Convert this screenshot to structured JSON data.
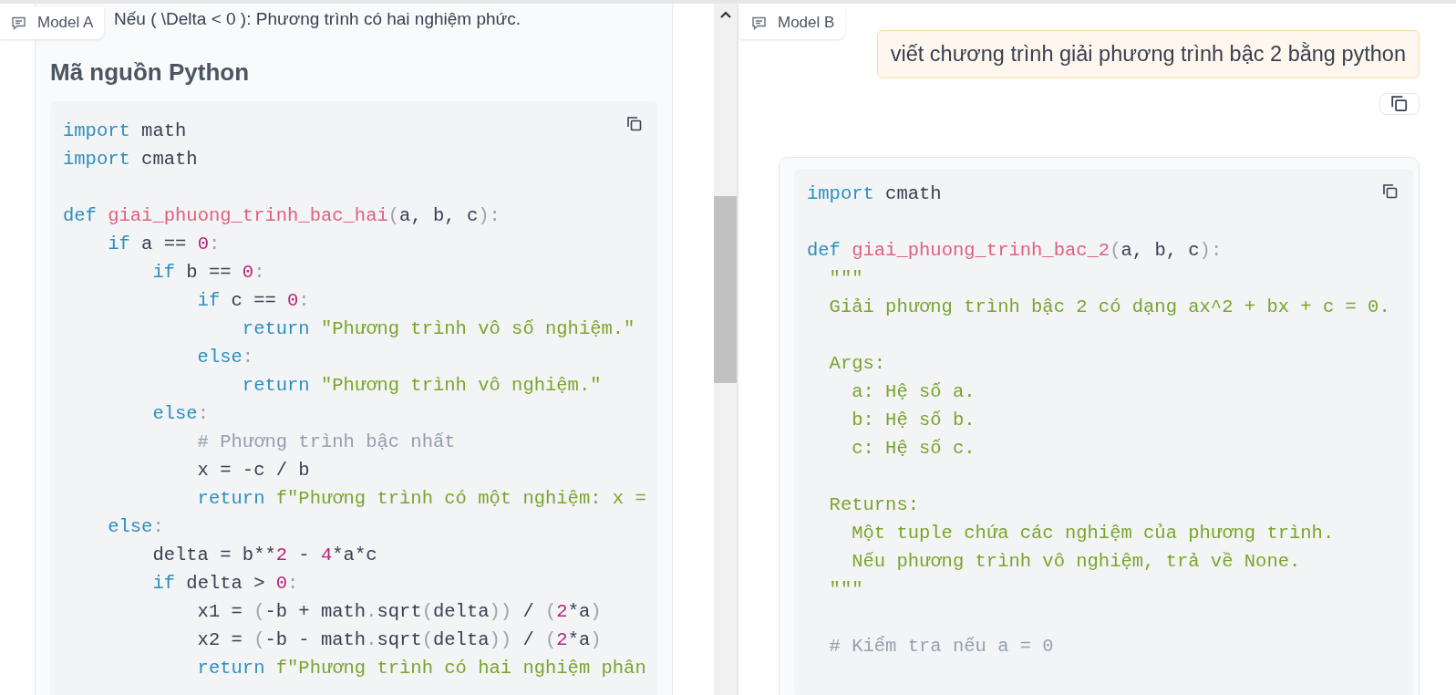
{
  "left_panel": {
    "tag": "Model A",
    "paragraph": "Nếu ( \\Delta < 0 ): Phương trình có hai nghiệm phức.",
    "heading": "Mã nguồn Python",
    "code": [
      {
        "kind": "code",
        "tokens": [
          {
            "kind": "kw",
            "t": "import"
          },
          {
            "kind": "p",
            "t": " math"
          }
        ]
      },
      {
        "kind": "code",
        "tokens": [
          {
            "kind": "kw",
            "t": "import"
          },
          {
            "kind": "p",
            "t": " cmath"
          }
        ]
      },
      {
        "kind": "blank"
      },
      {
        "kind": "code",
        "tokens": [
          {
            "kind": "kw",
            "t": "def "
          },
          {
            "kind": "fn",
            "t": "giai_phuong_trinh_bac_hai"
          },
          {
            "kind": "pu",
            "t": "("
          },
          {
            "kind": "p",
            "t": "a, b, c"
          },
          {
            "kind": "pu",
            "t": "):"
          }
        ]
      },
      {
        "kind": "code",
        "tokens": [
          {
            "kind": "kw",
            "t": "    if"
          },
          {
            "kind": "p",
            "t": " a == "
          },
          {
            "kind": "num",
            "t": "0"
          },
          {
            "kind": "pu",
            "t": ":"
          }
        ]
      },
      {
        "kind": "code",
        "tokens": [
          {
            "kind": "kw",
            "t": "        if"
          },
          {
            "kind": "p",
            "t": " b == "
          },
          {
            "kind": "num",
            "t": "0"
          },
          {
            "kind": "pu",
            "t": ":"
          }
        ]
      },
      {
        "kind": "code",
        "tokens": [
          {
            "kind": "kw",
            "t": "            if"
          },
          {
            "kind": "p",
            "t": " c == "
          },
          {
            "kind": "num",
            "t": "0"
          },
          {
            "kind": "pu",
            "t": ":"
          }
        ]
      },
      {
        "kind": "code",
        "tokens": [
          {
            "kind": "kw",
            "t": "                return "
          },
          {
            "kind": "str",
            "t": "\"Phương trình vô số nghiệm.\""
          }
        ]
      },
      {
        "kind": "code",
        "tokens": [
          {
            "kind": "kw",
            "t": "            else"
          },
          {
            "kind": "pu",
            "t": ":"
          }
        ]
      },
      {
        "kind": "code",
        "tokens": [
          {
            "kind": "kw",
            "t": "                return "
          },
          {
            "kind": "str",
            "t": "\"Phương trình vô nghiệm.\""
          }
        ]
      },
      {
        "kind": "code",
        "tokens": [
          {
            "kind": "kw",
            "t": "        else"
          },
          {
            "kind": "pu",
            "t": ":"
          }
        ]
      },
      {
        "kind": "code",
        "tokens": [
          {
            "kind": "cmt",
            "t": "            # Phương trình bậc nhất"
          }
        ]
      },
      {
        "kind": "code",
        "tokens": [
          {
            "kind": "p",
            "t": "            x = -c / b"
          }
        ]
      },
      {
        "kind": "code",
        "tokens": [
          {
            "kind": "kw",
            "t": "            return "
          },
          {
            "kind": "str",
            "t": "f\"Phương trình có một nghiệm: x ="
          }
        ]
      },
      {
        "kind": "code",
        "tokens": [
          {
            "kind": "kw",
            "t": "    else"
          },
          {
            "kind": "pu",
            "t": ":"
          }
        ]
      },
      {
        "kind": "code",
        "tokens": [
          {
            "kind": "p",
            "t": "        delta = b**"
          },
          {
            "kind": "num",
            "t": "2"
          },
          {
            "kind": "p",
            "t": " - "
          },
          {
            "kind": "num",
            "t": "4"
          },
          {
            "kind": "p",
            "t": "*a*c"
          }
        ]
      },
      {
        "kind": "code",
        "tokens": [
          {
            "kind": "kw",
            "t": "        if"
          },
          {
            "kind": "p",
            "t": " delta > "
          },
          {
            "kind": "num",
            "t": "0"
          },
          {
            "kind": "pu",
            "t": ":"
          }
        ]
      },
      {
        "kind": "code",
        "tokens": [
          {
            "kind": "p",
            "t": "            x1 = "
          },
          {
            "kind": "pu",
            "t": "("
          },
          {
            "kind": "p",
            "t": "-b + math"
          },
          {
            "kind": "pu",
            "t": "."
          },
          {
            "kind": "p",
            "t": "sqrt"
          },
          {
            "kind": "pu",
            "t": "("
          },
          {
            "kind": "p",
            "t": "delta"
          },
          {
            "kind": "pu",
            "t": "))"
          },
          {
            "kind": "p",
            "t": " / "
          },
          {
            "kind": "pu",
            "t": "("
          },
          {
            "kind": "num",
            "t": "2"
          },
          {
            "kind": "p",
            "t": "*a"
          },
          {
            "kind": "pu",
            "t": ")"
          }
        ]
      },
      {
        "kind": "code",
        "tokens": [
          {
            "kind": "p",
            "t": "            x2 = "
          },
          {
            "kind": "pu",
            "t": "("
          },
          {
            "kind": "p",
            "t": "-b - math"
          },
          {
            "kind": "pu",
            "t": "."
          },
          {
            "kind": "p",
            "t": "sqrt"
          },
          {
            "kind": "pu",
            "t": "("
          },
          {
            "kind": "p",
            "t": "delta"
          },
          {
            "kind": "pu",
            "t": "))"
          },
          {
            "kind": "p",
            "t": " / "
          },
          {
            "kind": "pu",
            "t": "("
          },
          {
            "kind": "num",
            "t": "2"
          },
          {
            "kind": "p",
            "t": "*a"
          },
          {
            "kind": "pu",
            "t": ")"
          }
        ]
      },
      {
        "kind": "code",
        "tokens": [
          {
            "kind": "kw",
            "t": "            return "
          },
          {
            "kind": "str",
            "t": "f\"Phương trình có hai nghiệm phân"
          }
        ]
      }
    ]
  },
  "right_panel": {
    "tag": "Model B",
    "user_message": "viết chương trình giải phương trình bậc 2 bằng python",
    "code": [
      {
        "kind": "code",
        "tokens": [
          {
            "kind": "kw",
            "t": "import"
          },
          {
            "kind": "p",
            "t": " cmath"
          }
        ]
      },
      {
        "kind": "blank"
      },
      {
        "kind": "code",
        "tokens": [
          {
            "kind": "kw",
            "t": "def "
          },
          {
            "kind": "fn",
            "t": "giai_phuong_trinh_bac_2"
          },
          {
            "kind": "pu",
            "t": "("
          },
          {
            "kind": "p",
            "t": "a, b, c"
          },
          {
            "kind": "pu",
            "t": "):"
          }
        ]
      },
      {
        "kind": "code",
        "tokens": [
          {
            "kind": "str",
            "t": "  \"\"\""
          }
        ]
      },
      {
        "kind": "code",
        "tokens": [
          {
            "kind": "str",
            "t": "  Giải phương trình bậc 2 có dạng ax^2 + bx + c = 0."
          }
        ]
      },
      {
        "kind": "blank"
      },
      {
        "kind": "code",
        "tokens": [
          {
            "kind": "str",
            "t": "  Args:"
          }
        ]
      },
      {
        "kind": "code",
        "tokens": [
          {
            "kind": "str",
            "t": "    a: Hệ số a."
          }
        ]
      },
      {
        "kind": "code",
        "tokens": [
          {
            "kind": "str",
            "t": "    b: Hệ số b."
          }
        ]
      },
      {
        "kind": "code",
        "tokens": [
          {
            "kind": "str",
            "t": "    c: Hệ số c."
          }
        ]
      },
      {
        "kind": "blank"
      },
      {
        "kind": "code",
        "tokens": [
          {
            "kind": "str",
            "t": "  Returns:"
          }
        ]
      },
      {
        "kind": "code",
        "tokens": [
          {
            "kind": "str",
            "t": "    Một tuple chứa các nghiệm của phương trình."
          }
        ]
      },
      {
        "kind": "code",
        "tokens": [
          {
            "kind": "str",
            "t": "    Nếu phương trình vô nghiệm, trả về None."
          }
        ]
      },
      {
        "kind": "code",
        "tokens": [
          {
            "kind": "str",
            "t": "  \"\"\""
          }
        ]
      },
      {
        "kind": "blank"
      },
      {
        "kind": "code",
        "tokens": [
          {
            "kind": "cmt",
            "t": "  # Kiểm tra nếu a = 0"
          }
        ]
      }
    ]
  }
}
